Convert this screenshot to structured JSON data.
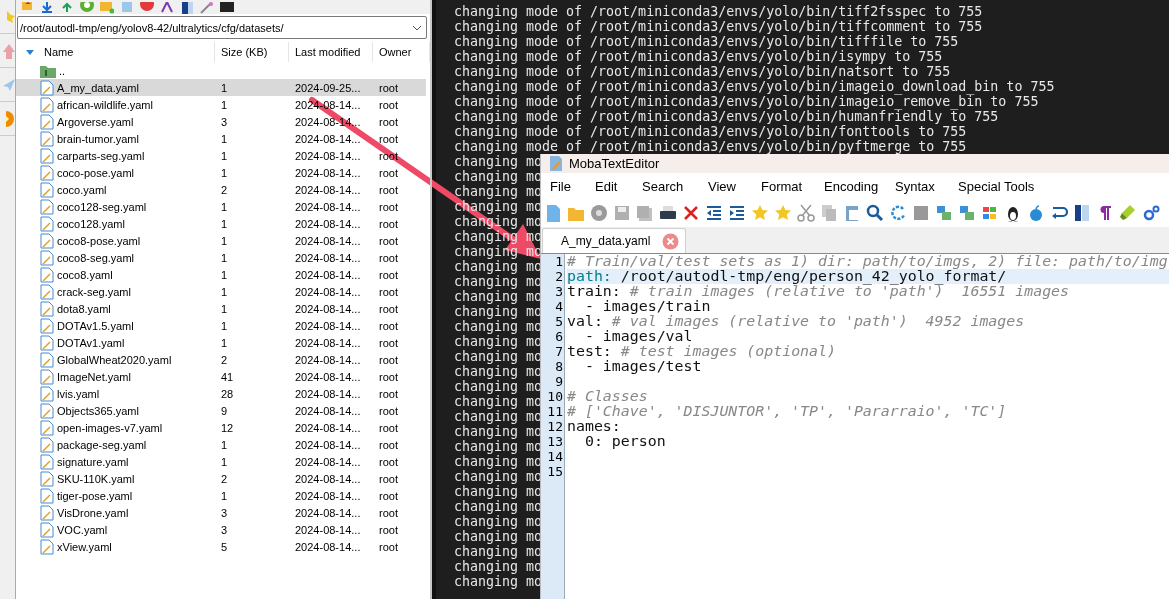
{
  "file_browser": {
    "path": "/root/autodl-tmp/eng/yolov8-42/ultralytics/cfg/datasets/",
    "columns": [
      "Name",
      "Size (KB)",
      "Last modified",
      "Owner"
    ],
    "rows": [
      {
        "kind": "parent",
        "name": "..",
        "selected": false
      },
      {
        "kind": "file",
        "name": "A_my_data.yaml",
        "size": "1",
        "modified": "2024-09-25...",
        "owner": "root",
        "selected": true
      },
      {
        "kind": "file",
        "name": "african-wildlife.yaml",
        "size": "1",
        "modified": "2024-08-14...",
        "owner": "root",
        "selected": false
      },
      {
        "kind": "file",
        "name": "Argoverse.yaml",
        "size": "3",
        "modified": "2024-08-14...",
        "owner": "root",
        "selected": false
      },
      {
        "kind": "file",
        "name": "brain-tumor.yaml",
        "size": "1",
        "modified": "2024-08-14...",
        "owner": "root",
        "selected": false
      },
      {
        "kind": "file",
        "name": "carparts-seg.yaml",
        "size": "1",
        "modified": "2024-08-14...",
        "owner": "root",
        "selected": false
      },
      {
        "kind": "file",
        "name": "coco-pose.yaml",
        "size": "1",
        "modified": "2024-08-14...",
        "owner": "root",
        "selected": false
      },
      {
        "kind": "file",
        "name": "coco.yaml",
        "size": "2",
        "modified": "2024-08-14...",
        "owner": "root",
        "selected": false
      },
      {
        "kind": "file",
        "name": "coco128-seg.yaml",
        "size": "1",
        "modified": "2024-08-14...",
        "owner": "root",
        "selected": false
      },
      {
        "kind": "file",
        "name": "coco128.yaml",
        "size": "1",
        "modified": "2024-08-14...",
        "owner": "root",
        "selected": false
      },
      {
        "kind": "file",
        "name": "coco8-pose.yaml",
        "size": "1",
        "modified": "2024-08-14...",
        "owner": "root",
        "selected": false
      },
      {
        "kind": "file",
        "name": "coco8-seg.yaml",
        "size": "1",
        "modified": "2024-08-14...",
        "owner": "root",
        "selected": false
      },
      {
        "kind": "file",
        "name": "coco8.yaml",
        "size": "1",
        "modified": "2024-08-14...",
        "owner": "root",
        "selected": false
      },
      {
        "kind": "file",
        "name": "crack-seg.yaml",
        "size": "1",
        "modified": "2024-08-14...",
        "owner": "root",
        "selected": false
      },
      {
        "kind": "file",
        "name": "dota8.yaml",
        "size": "1",
        "modified": "2024-08-14...",
        "owner": "root",
        "selected": false
      },
      {
        "kind": "file",
        "name": "DOTAv1.5.yaml",
        "size": "1",
        "modified": "2024-08-14...",
        "owner": "root",
        "selected": false
      },
      {
        "kind": "file",
        "name": "DOTAv1.yaml",
        "size": "1",
        "modified": "2024-08-14...",
        "owner": "root",
        "selected": false
      },
      {
        "kind": "file",
        "name": "GlobalWheat2020.yaml",
        "size": "2",
        "modified": "2024-08-14...",
        "owner": "root",
        "selected": false
      },
      {
        "kind": "file",
        "name": "ImageNet.yaml",
        "size": "41",
        "modified": "2024-08-14...",
        "owner": "root",
        "selected": false
      },
      {
        "kind": "file",
        "name": "lvis.yaml",
        "size": "28",
        "modified": "2024-08-14...",
        "owner": "root",
        "selected": false
      },
      {
        "kind": "file",
        "name": "Objects365.yaml",
        "size": "9",
        "modified": "2024-08-14...",
        "owner": "root",
        "selected": false
      },
      {
        "kind": "file",
        "name": "open-images-v7.yaml",
        "size": "12",
        "modified": "2024-08-14...",
        "owner": "root",
        "selected": false
      },
      {
        "kind": "file",
        "name": "package-seg.yaml",
        "size": "1",
        "modified": "2024-08-14...",
        "owner": "root",
        "selected": false
      },
      {
        "kind": "file",
        "name": "signature.yaml",
        "size": "1",
        "modified": "2024-08-14...",
        "owner": "root",
        "selected": false
      },
      {
        "kind": "file",
        "name": "SKU-110K.yaml",
        "size": "2",
        "modified": "2024-08-14...",
        "owner": "root",
        "selected": false
      },
      {
        "kind": "file",
        "name": "tiger-pose.yaml",
        "size": "1",
        "modified": "2024-08-14...",
        "owner": "root",
        "selected": false
      },
      {
        "kind": "file",
        "name": "VisDrone.yaml",
        "size": "3",
        "modified": "2024-08-14...",
        "owner": "root",
        "selected": false
      },
      {
        "kind": "file",
        "name": "VOC.yaml",
        "size": "3",
        "modified": "2024-08-14...",
        "owner": "root",
        "selected": false
      },
      {
        "kind": "file",
        "name": "xView.yaml",
        "size": "5",
        "modified": "2024-08-14...",
        "owner": "root",
        "selected": false
      }
    ]
  },
  "terminal": {
    "lines": [
      "changing mode of /root/miniconda3/envs/yolo/bin/tiff2fsspec to 755",
      "changing mode of /root/miniconda3/envs/yolo/bin/tiffcomment to 755",
      "changing mode of /root/miniconda3/envs/yolo/bin/tifffile to 755",
      "changing mode of /root/miniconda3/envs/yolo/bin/isympy to 755",
      "changing mode of /root/miniconda3/envs/yolo/bin/natsort to 755",
      "changing mode of /root/miniconda3/envs/yolo/bin/imageio_download_bin to 755",
      "changing mode of /root/miniconda3/envs/yolo/bin/imageio_remove_bin to 755",
      "changing mode of /root/miniconda3/envs/yolo/bin/humanfriendly to 755",
      "changing mode of /root/miniconda3/envs/yolo/bin/fonttools to 755",
      "changing mode of /root/miniconda3/envs/yolo/bin/pyftmerge to 755",
      "changing mo",
      "changing mo",
      "changing mo",
      "changing mo",
      "changing mo",
      "changing mo",
      "changing mo",
      "changing mo",
      "changing mo",
      "changing mo",
      "changing mo",
      "changing mo",
      "changing mo",
      "changing mo",
      "changing mo",
      "changing mo",
      "changing mo",
      "changing mo",
      "changing mo",
      "changing mo",
      "changing mo",
      "changing mo",
      "changing mo",
      "changing mo",
      "changing mo",
      "changing mo",
      "changing mo",
      "changing mo",
      "changing mo"
    ]
  },
  "editor": {
    "title": "MobaTextEditor",
    "menu": [
      "File",
      "Edit",
      "Search",
      "View",
      "Format",
      "Encoding",
      "Syntax",
      "Special Tools"
    ],
    "tabs": [
      {
        "label": "A_my_data.yaml",
        "selected": true
      }
    ],
    "lines": [
      {
        "number": "1",
        "current": false,
        "parts": [
          {
            "kind": "comment",
            "text": "# Train/val/test sets as 1) dir: path/to/imgs, 2) file: path/to/img"
          }
        ]
      },
      {
        "number": "2",
        "current": true,
        "parts": [
          {
            "kind": "key",
            "text": "path:"
          },
          {
            "kind": "plain",
            "text": " /root/autodl-tmp/eng/person_42_yolo_format/"
          }
        ]
      },
      {
        "number": "3",
        "current": false,
        "parts": [
          {
            "kind": "plain",
            "text": "train: "
          },
          {
            "kind": "comment",
            "text": "# train images (relative to 'path')  16551 images"
          }
        ]
      },
      {
        "number": "4",
        "current": false,
        "parts": [
          {
            "kind": "plain",
            "text": "  - images/train"
          }
        ]
      },
      {
        "number": "5",
        "current": false,
        "parts": [
          {
            "kind": "plain",
            "text": "val: "
          },
          {
            "kind": "comment",
            "text": "# val images (relative to 'path')  4952 images"
          }
        ]
      },
      {
        "number": "6",
        "current": false,
        "parts": [
          {
            "kind": "plain",
            "text": "  - images/val"
          }
        ]
      },
      {
        "number": "7",
        "current": false,
        "parts": [
          {
            "kind": "plain",
            "text": "test: "
          },
          {
            "kind": "comment",
            "text": "# test images (optional)"
          }
        ]
      },
      {
        "number": "8",
        "current": false,
        "parts": [
          {
            "kind": "plain",
            "text": "  - images/test"
          }
        ]
      },
      {
        "number": "9",
        "current": false
      },
      {
        "number": "10",
        "current": false,
        "parts": [
          {
            "kind": "comment",
            "text": "# Classes"
          }
        ]
      },
      {
        "number": "11",
        "current": false,
        "parts": [
          {
            "kind": "comment",
            "text": "# ['Chave', 'DISJUNTOR', 'TP', 'Pararraio', 'TC']"
          }
        ]
      },
      {
        "number": "12",
        "current": false,
        "parts": [
          {
            "kind": "plain",
            "text": "names:"
          }
        ]
      },
      {
        "number": "13",
        "current": false,
        "parts": [
          {
            "kind": "plain",
            "text": "  0: person"
          }
        ]
      },
      {
        "number": "14",
        "current": false
      },
      {
        "number": "15",
        "current": false
      }
    ]
  }
}
